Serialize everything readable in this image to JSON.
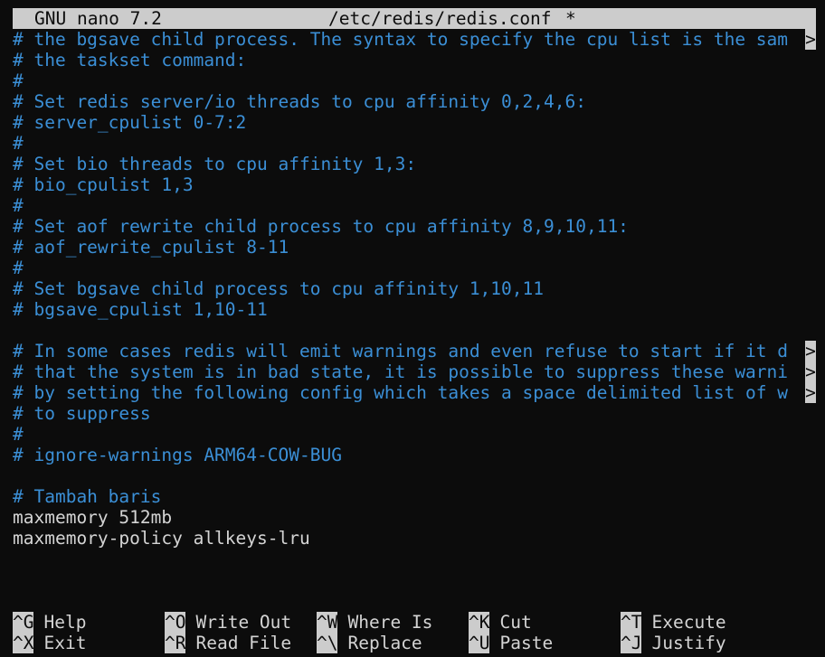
{
  "titlebar": {
    "app": "GNU nano 7.2",
    "filename": "/etc/redis/redis.conf",
    "modified_marker": "*"
  },
  "editor": {
    "lines": [
      {
        "text": "# the bgsave child process. The syntax to specify the cpu list is the sam",
        "kind": "comment",
        "overflow": true
      },
      {
        "text": "# the taskset command:",
        "kind": "comment",
        "overflow": false
      },
      {
        "text": "#",
        "kind": "comment",
        "overflow": false
      },
      {
        "text": "# Set redis server/io threads to cpu affinity 0,2,4,6:",
        "kind": "comment",
        "overflow": false
      },
      {
        "text": "# server_cpulist 0-7:2",
        "kind": "comment",
        "overflow": false
      },
      {
        "text": "#",
        "kind": "comment",
        "overflow": false
      },
      {
        "text": "# Set bio threads to cpu affinity 1,3:",
        "kind": "comment",
        "overflow": false
      },
      {
        "text": "# bio_cpulist 1,3",
        "kind": "comment",
        "overflow": false
      },
      {
        "text": "#",
        "kind": "comment",
        "overflow": false
      },
      {
        "text": "# Set aof rewrite child process to cpu affinity 8,9,10,11:",
        "kind": "comment",
        "overflow": false
      },
      {
        "text": "# aof_rewrite_cpulist 8-11",
        "kind": "comment",
        "overflow": false
      },
      {
        "text": "#",
        "kind": "comment",
        "overflow": false
      },
      {
        "text": "# Set bgsave child process to cpu affinity 1,10,11",
        "kind": "comment",
        "overflow": false
      },
      {
        "text": "# bgsave_cpulist 1,10-11",
        "kind": "comment",
        "overflow": false
      },
      {
        "text": "",
        "kind": "plain",
        "overflow": false
      },
      {
        "text": "# In some cases redis will emit warnings and even refuse to start if it d",
        "kind": "comment",
        "overflow": true
      },
      {
        "text": "# that the system is in bad state, it is possible to suppress these warni",
        "kind": "comment",
        "overflow": true
      },
      {
        "text": "# by setting the following config which takes a space delimited list of w",
        "kind": "comment",
        "overflow": true
      },
      {
        "text": "# to suppress",
        "kind": "comment",
        "overflow": false
      },
      {
        "text": "#",
        "kind": "comment",
        "overflow": false
      },
      {
        "text": "# ignore-warnings ARM64-COW-BUG",
        "kind": "comment",
        "overflow": false
      },
      {
        "text": "",
        "kind": "plain",
        "overflow": false
      },
      {
        "text": "# Tambah baris",
        "kind": "comment",
        "overflow": false
      },
      {
        "text": "maxmemory 512mb",
        "kind": "plain",
        "overflow": false
      },
      {
        "text": "maxmemory-policy allkeys-lru",
        "kind": "plain",
        "overflow": false
      }
    ],
    "overflow_marker": ">"
  },
  "shortcuts": [
    {
      "key": "^G",
      "label": "Help"
    },
    {
      "key": "^O",
      "label": "Write Out"
    },
    {
      "key": "^W",
      "label": "Where Is"
    },
    {
      "key": "^K",
      "label": "Cut"
    },
    {
      "key": "^T",
      "label": "Execute"
    },
    {
      "key": "^X",
      "label": "Exit"
    },
    {
      "key": "^R",
      "label": "Read File"
    },
    {
      "key": "^\\",
      "label": "Replace"
    },
    {
      "key": "^U",
      "label": "Paste"
    },
    {
      "key": "^J",
      "label": "Justify"
    }
  ]
}
